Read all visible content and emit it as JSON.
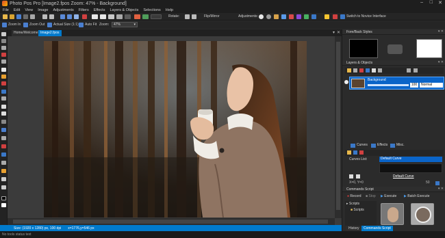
{
  "window": {
    "title": "Photo Pos Pro [Image2.fpos Zoom: 47% - Background]"
  },
  "menu": [
    "File",
    "Edit",
    "View",
    "Image",
    "Adjustments",
    "Filters",
    "Effects",
    "Layers & Objects",
    "Selections",
    "Help"
  ],
  "toolbar1": {
    "rotate_label": "Rotate:",
    "flip_label": "Flip/Mirror",
    "adjustments_label": "Adjustments:",
    "novice_label": "Switch to Novice Interface"
  },
  "toolbar2": {
    "zoom_in": "Zoom In",
    "zoom_out": "Zoom Out",
    "actual_size": "Actual Size (1:1)",
    "auto_fit": "Auto Fit",
    "zoom_label": "Zoom:",
    "zoom_value": "47%"
  },
  "doc_tabs": [
    "Home/Welcome",
    "Image2.fpos"
  ],
  "status": {
    "size": "Size: (1920 x 1280) px, 100 dpi",
    "coords": "x=1776,y=546 px"
  },
  "footer": "No tools status text",
  "panels": {
    "fore_back": "Fore/Back Styles",
    "layers": "Layers & Objects",
    "layer_name": "Background",
    "layer_opacity": "100",
    "layer_mode": "Normal",
    "subtabs": [
      "Curves",
      "Effects",
      "Misc."
    ],
    "curves_list_label": "Curves List:",
    "curve_selected": "Default Curve",
    "curve_link": "Default Curve",
    "curve_coords": "X=0, Y=0",
    "curve_value": "50",
    "commands": "Commands Script",
    "record": "Record",
    "stop": "Stop",
    "execute": "Execute",
    "batch_execute": "Batch Execute",
    "scripts_root": "Scripts",
    "scripts_child": "Scripts",
    "bottom_tabs": [
      "History",
      "Commands Script"
    ]
  },
  "colors": {
    "accent": "#007acc",
    "selection": "#0a64c8",
    "background": "#2b2b2b"
  }
}
